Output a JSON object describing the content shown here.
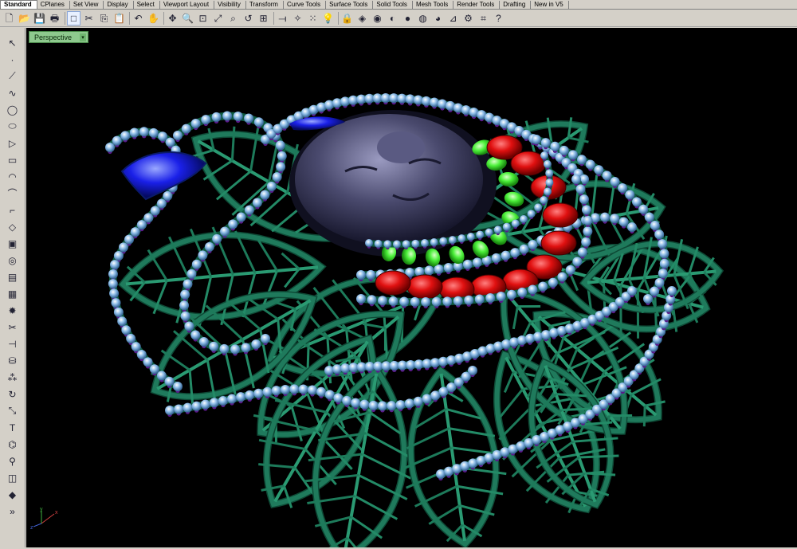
{
  "tabs": [
    "Standard",
    "CPlanes",
    "Set View",
    "Display",
    "Select",
    "Viewport Layout",
    "Visibility",
    "Transform",
    "Curve Tools",
    "Surface Tools",
    "Solid Tools",
    "Mesh Tools",
    "Render Tools",
    "Drafting",
    "New in V5"
  ],
  "active_tab": "Standard",
  "viewport": {
    "label": "Perspective",
    "dropdown": "▾"
  },
  "toolbar_icons": [
    {
      "name": "new-file-icon",
      "glyph": "🗋"
    },
    {
      "name": "open-file-icon",
      "glyph": "📂"
    },
    {
      "name": "save-icon",
      "glyph": "💾"
    },
    {
      "name": "print-icon",
      "glyph": "🖶"
    },
    {
      "name": "blank-icon",
      "glyph": "□"
    },
    {
      "name": "cut-icon",
      "glyph": "✂"
    },
    {
      "name": "copy-icon",
      "glyph": "⎘"
    },
    {
      "name": "paste-icon",
      "glyph": "📋"
    },
    {
      "name": "undo-icon",
      "glyph": "↶"
    },
    {
      "name": "pan-hand-icon",
      "glyph": "✋"
    },
    {
      "name": "rotate-view-icon",
      "glyph": "✥"
    },
    {
      "name": "zoom-icon",
      "glyph": "🔍"
    },
    {
      "name": "zoom-window-icon",
      "glyph": "⊡"
    },
    {
      "name": "zoom-extents-icon",
      "glyph": "⤢"
    },
    {
      "name": "zoom-selected-icon",
      "glyph": "⌕"
    },
    {
      "name": "undo-view-icon",
      "glyph": "↺"
    },
    {
      "name": "four-view-icon",
      "glyph": "⊞"
    },
    {
      "name": "cplane-icon",
      "glyph": "⟞"
    },
    {
      "name": "osnap-icon",
      "glyph": "✧"
    },
    {
      "name": "select-points-icon",
      "glyph": "⁙"
    },
    {
      "name": "light-bulb-icon",
      "glyph": "💡"
    },
    {
      "name": "lock-icon",
      "glyph": "🔒"
    },
    {
      "name": "layer-icon",
      "glyph": "◈"
    },
    {
      "name": "color-wheel-icon",
      "glyph": "◉"
    },
    {
      "name": "shade-icon",
      "glyph": "◐"
    },
    {
      "name": "render-sphere-icon",
      "glyph": "●"
    },
    {
      "name": "material-sphere-icon",
      "glyph": "◍"
    },
    {
      "name": "environment-sphere-icon",
      "glyph": "◕"
    },
    {
      "name": "dimension-icon",
      "glyph": "⊿"
    },
    {
      "name": "settings-gear-icon",
      "glyph": "⚙"
    },
    {
      "name": "options-icon",
      "glyph": "⌗"
    },
    {
      "name": "help-icon",
      "glyph": "?"
    }
  ],
  "left_icons": [
    {
      "name": "select-arrow-icon",
      "glyph": "↖"
    },
    {
      "name": "point-icon",
      "glyph": "·"
    },
    {
      "name": "polyline-icon",
      "glyph": "⟋"
    },
    {
      "name": "curve-icon",
      "glyph": "∿"
    },
    {
      "name": "circle-icon",
      "glyph": "◯"
    },
    {
      "name": "ellipse-icon",
      "glyph": "⬭"
    },
    {
      "name": "polygon-icon",
      "glyph": "▷"
    },
    {
      "name": "rectangle-icon",
      "glyph": "▭"
    },
    {
      "name": "arc-icon",
      "glyph": "◠"
    },
    {
      "name": "free-curve-icon",
      "glyph": "⌒"
    },
    {
      "name": "fillet-icon",
      "glyph": "⌐"
    },
    {
      "name": "surface-icon",
      "glyph": "◇"
    },
    {
      "name": "box-solid-icon",
      "glyph": "▣"
    },
    {
      "name": "boolean-icon",
      "glyph": "◎"
    },
    {
      "name": "extrude-icon",
      "glyph": "▤"
    },
    {
      "name": "mesh-icon",
      "glyph": "▦"
    },
    {
      "name": "explode-icon",
      "glyph": "✹"
    },
    {
      "name": "trim-icon",
      "glyph": "✂"
    },
    {
      "name": "split-icon",
      "glyph": "⊣"
    },
    {
      "name": "group-icon",
      "glyph": "⛁"
    },
    {
      "name": "array-icon",
      "glyph": "⁂"
    },
    {
      "name": "rotate-icon",
      "glyph": "↻"
    },
    {
      "name": "scale-icon",
      "glyph": "⤡"
    },
    {
      "name": "text-icon",
      "glyph": "T"
    },
    {
      "name": "point-edit-icon",
      "glyph": "⌬"
    },
    {
      "name": "analyze-icon",
      "glyph": "⚲"
    },
    {
      "name": "layout-icon",
      "glyph": "◫"
    },
    {
      "name": "render-box-icon",
      "glyph": "◆"
    },
    {
      "name": "more-tools-icon",
      "glyph": "»"
    }
  ],
  "colors": {
    "viewport_bg": "#000000",
    "leaf_green": "#1f7a5c",
    "bead": "#8fbde8",
    "prong": "#5a1a8a",
    "ruby": "#e01010",
    "emerald": "#4cf03a",
    "sapphire": "#1a20e8",
    "face": "#4a4a6a"
  }
}
